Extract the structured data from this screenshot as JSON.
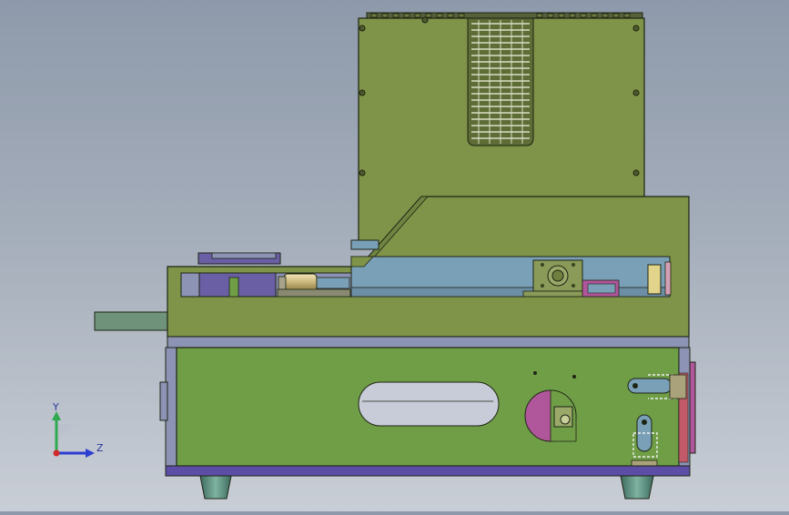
{
  "viewport": {
    "background_top": "#8e9aab",
    "background_bottom": "#c9ced6"
  },
  "model": {
    "colors": {
      "body_green": "#7f9448",
      "lower_green": "#6f9e47",
      "purple": "#6a5ea5",
      "light_blue": "#7aa0b8",
      "grey_blue": "#8c93b5",
      "teal_feet": "#5f8f80",
      "pink_wheel": "#b0569a",
      "edge": "#1e2414"
    }
  },
  "triad": {
    "y_label": "Y",
    "z_label": "Z",
    "y_color": "#2faa4f",
    "z_color": "#2d3ed1",
    "origin_color": "#d12a2a"
  }
}
